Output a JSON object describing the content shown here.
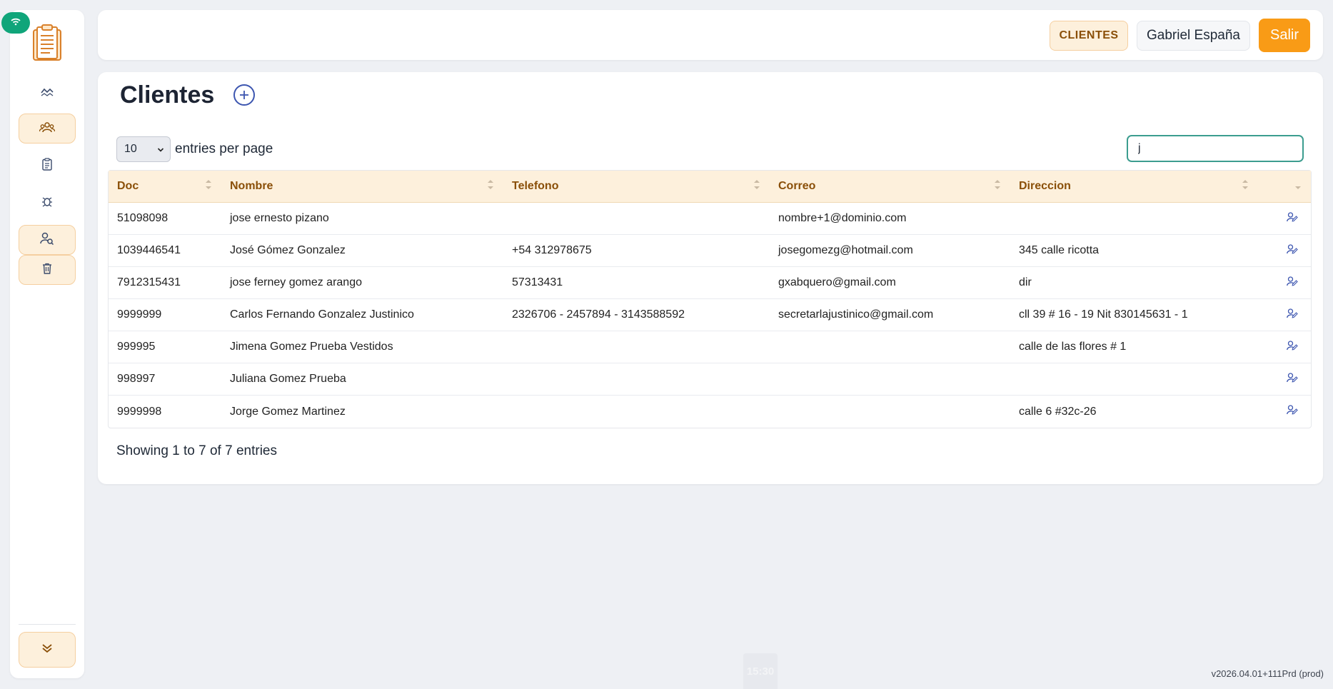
{
  "sidebar": {
    "items": [
      {
        "name": "chart-icon",
        "active": false
      },
      {
        "name": "users-group-icon",
        "active": true
      },
      {
        "name": "clipboard-icon",
        "active": false
      },
      {
        "name": "bug-icon",
        "active": false
      },
      {
        "name": "user-search-icon",
        "active": true
      },
      {
        "name": "trash-icon",
        "active": true
      }
    ]
  },
  "header": {
    "section_label": "CLIENTES",
    "user_name": "Gabriel España",
    "logout_label": "Salir"
  },
  "main": {
    "title": "Clientes",
    "entries_value": "10",
    "entries_label": "entries per page",
    "search_value": "j",
    "columns": [
      "Doc",
      "Nombre",
      "Telefono",
      "Correo",
      "Direccion"
    ],
    "rows": [
      {
        "doc": "51098098",
        "nombre": "jose ernesto pizano",
        "telefono": "",
        "correo": "nombre+1@dominio.com",
        "direccion": ""
      },
      {
        "doc": "1039446541",
        "nombre": "José Gómez Gonzalez",
        "telefono": "+54 312978675",
        "correo": "josegomezg@hotmail.com",
        "direccion": "345 calle ricotta"
      },
      {
        "doc": "7912315431",
        "nombre": "jose ferney gomez arango",
        "telefono": "57313431",
        "correo": "gxabquero@gmail.com",
        "direccion": "dir"
      },
      {
        "doc": "9999999",
        "nombre": "Carlos Fernando Gonzalez Justinico",
        "telefono": "2326706 - 2457894 - 3143588592",
        "correo": "secretarlajustinico@gmail.com",
        "direccion": "cll 39 # 16 - 19 Nit 830145631 - 1"
      },
      {
        "doc": "999995",
        "nombre": "Jimena Gomez Prueba Vestidos",
        "telefono": "",
        "correo": "",
        "direccion": "calle de las flores # 1"
      },
      {
        "doc": "998997",
        "nombre": "Juliana Gomez Prueba",
        "telefono": "",
        "correo": "",
        "direccion": ""
      },
      {
        "doc": "9999998",
        "nombre": "Jorge Gomez Martinez",
        "telefono": "",
        "correo": "",
        "direccion": "calle 6 #32c-26"
      }
    ],
    "showing": "Showing 1 to 7 of 7 entries"
  },
  "footer": {
    "clock": "15:30",
    "version": "v2026.04.01+111Prd (prod)"
  },
  "colors": {
    "accent": "#f99b16",
    "header_bg": "#fdf0dc",
    "header_text": "#8a4f08",
    "link": "#3d56b0",
    "online": "#10a57a"
  }
}
